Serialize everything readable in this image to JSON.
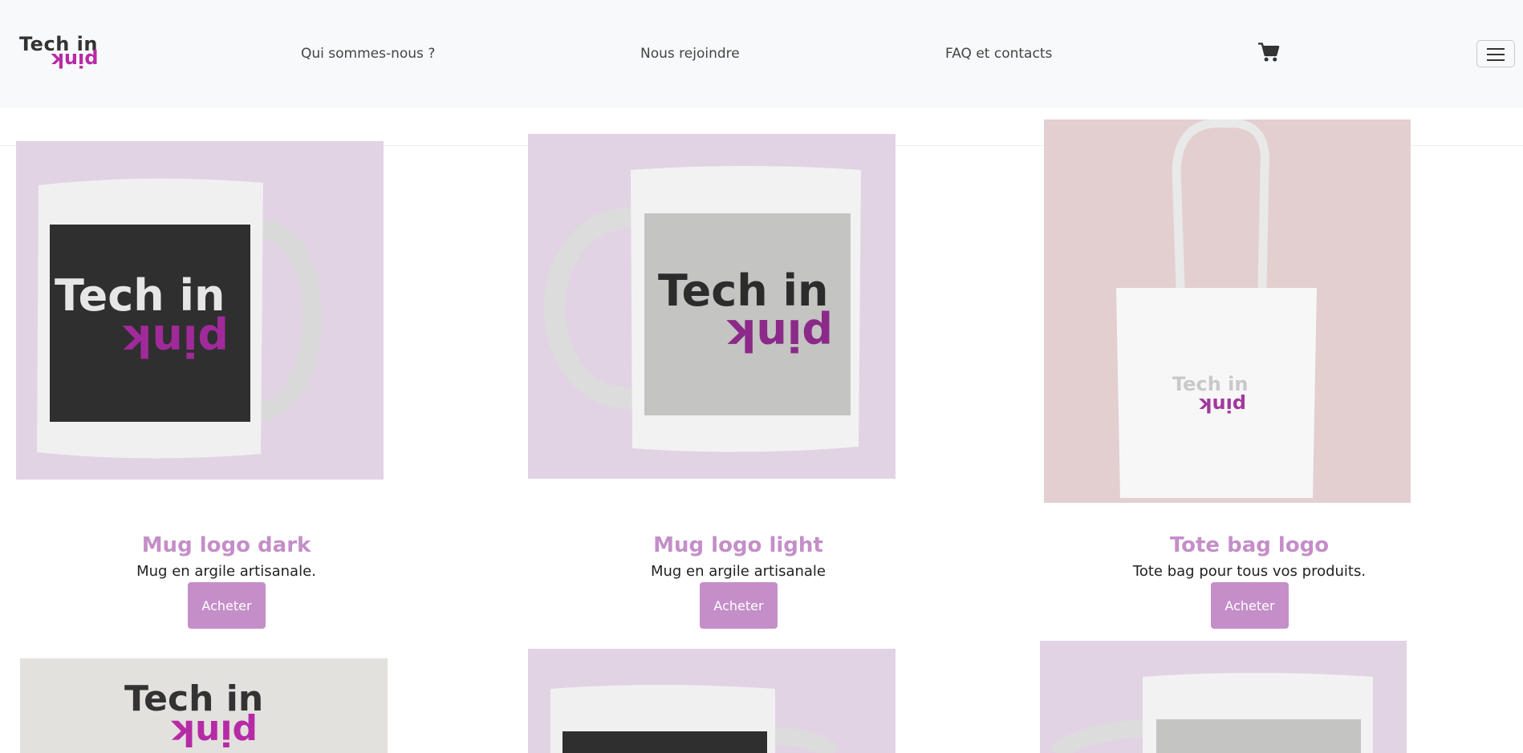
{
  "brand": {
    "line1": "Tech in",
    "line2": "pink"
  },
  "nav": {
    "links": [
      "Qui sommes-nous ?",
      "Nous rejoindre",
      "FAQ et contacts"
    ]
  },
  "icons": {
    "cart": "shopping-cart-icon",
    "menu": "hamburger-menu-icon"
  },
  "colors": {
    "accent": "#c48ec8",
    "brand_pink": "#b72aa6",
    "navbar_bg": "#f8f9fa"
  },
  "products": [
    {
      "title": "Mug logo dark",
      "description": "Mug en argile artisanale.",
      "button": "Acheter"
    },
    {
      "title": "Mug logo light",
      "description": "Mug en argile artisanale",
      "button": "Acheter"
    },
    {
      "title": "Tote bag logo",
      "description": "Tote bag pour tous vos produits.",
      "button": "Acheter"
    }
  ],
  "mockup_logo": {
    "line1": "Tech in",
    "line2": "pink"
  }
}
